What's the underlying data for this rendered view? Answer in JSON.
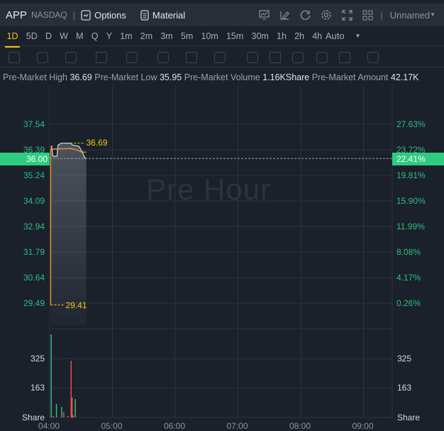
{
  "header": {
    "symbol": "APP",
    "exchange": "NASDAQ",
    "options_label": "Options",
    "material_label": "Material",
    "layout_name": "Unnamed",
    "icons": [
      "indicator-icon",
      "draw-icon",
      "refresh-icon",
      "settings-icon",
      "fullscreen-icon",
      "grid-layout-icon"
    ]
  },
  "timeframes": [
    "1D",
    "5D",
    "D",
    "W",
    "M",
    "Q",
    "Y",
    "1m",
    "2m",
    "3m",
    "5m",
    "10m",
    "15m",
    "30m",
    "1h",
    "2h",
    "4h"
  ],
  "active_timeframe": "1D",
  "scale_mode": "Auto",
  "drawing_tools": [
    "line-tool-icon",
    "rectangle-tool-icon",
    "pattern-tool-icon",
    "fib-tool-icon",
    "arrow-tool-icon",
    "measure-tool-icon",
    "text-tool-icon",
    "candle-tool-icon",
    "pen-icon",
    "lock-icon",
    "eye-icon",
    "magnet-icon",
    "layers-icon",
    "trash-icon"
  ],
  "info": {
    "high_label": "Pre-Market High",
    "high": "36.69",
    "low_label": "Pre-Market Low",
    "low": "35.95",
    "volume_label": "Pre-Market Volume",
    "volume": "1.16KShare",
    "amount_label": "Pre-Market Amount",
    "amount": "42.17K"
  },
  "watermark": "Pre Hour",
  "colors": {
    "up": "#2ebd7f",
    "down": "#f04a4a",
    "avg": "#f59a23",
    "price": "#c9ced6",
    "marker": "#f0c419",
    "current": "#2ecc7f"
  },
  "chart_data": {
    "type": "line",
    "price_axis": {
      "ticks": [
        "37.54",
        "36.39",
        "35.24",
        "34.09",
        "32.94",
        "31.79",
        "30.64",
        "29.49"
      ],
      "range": [
        29.49,
        37.54
      ]
    },
    "percent_axis": {
      "ticks": [
        "27.63%",
        "23.72%",
        "19.81%",
        "15.90%",
        "11.99%",
        "8.08%",
        "4.17%",
        "0.26%"
      ]
    },
    "current": {
      "price": "36.00",
      "percent": "22.41%"
    },
    "high_marker": "36.69",
    "low_marker": "29.41",
    "time_ticks": [
      "04:00",
      "05:00",
      "06:00",
      "07:00",
      "08:00",
      "09:00"
    ],
    "time_range": [
      "04:00",
      "09:28"
    ],
    "price_series": [
      [
        "04:01",
        36.52
      ],
      [
        "04:02",
        36.55
      ],
      [
        "04:03",
        36.1
      ],
      [
        "04:07",
        36.1
      ],
      [
        "04:08",
        36.6
      ],
      [
        "04:11",
        36.69
      ],
      [
        "04:20",
        36.69
      ],
      [
        "04:22",
        36.6
      ],
      [
        "04:28",
        36.55
      ],
      [
        "04:31",
        36.3
      ],
      [
        "04:33",
        36.1
      ],
      [
        "04:34",
        36.0
      ],
      [
        "04:35",
        36.02
      ]
    ],
    "avg_series": [
      [
        "04:01",
        29.41
      ],
      [
        "04:01",
        36.42
      ],
      [
        "04:20",
        36.45
      ],
      [
        "04:25",
        36.4
      ],
      [
        "04:30",
        36.3
      ],
      [
        "04:35",
        36.28
      ]
    ],
    "volume_axis": {
      "ticks": [
        "325",
        "163"
      ],
      "unit": "Share"
    },
    "volume": [
      [
        "04:01",
        454,
        "up"
      ],
      [
        "04:03",
        8,
        "down"
      ],
      [
        "04:06",
        74,
        "up"
      ],
      [
        "04:11",
        58,
        "up"
      ],
      [
        "04:13",
        31,
        "down"
      ],
      [
        "04:17",
        8,
        "down"
      ],
      [
        "04:20",
        310,
        "down"
      ],
      [
        "04:21",
        109,
        "down"
      ],
      [
        "04:22",
        12,
        "down"
      ],
      [
        "04:24",
        101,
        "up"
      ]
    ]
  }
}
